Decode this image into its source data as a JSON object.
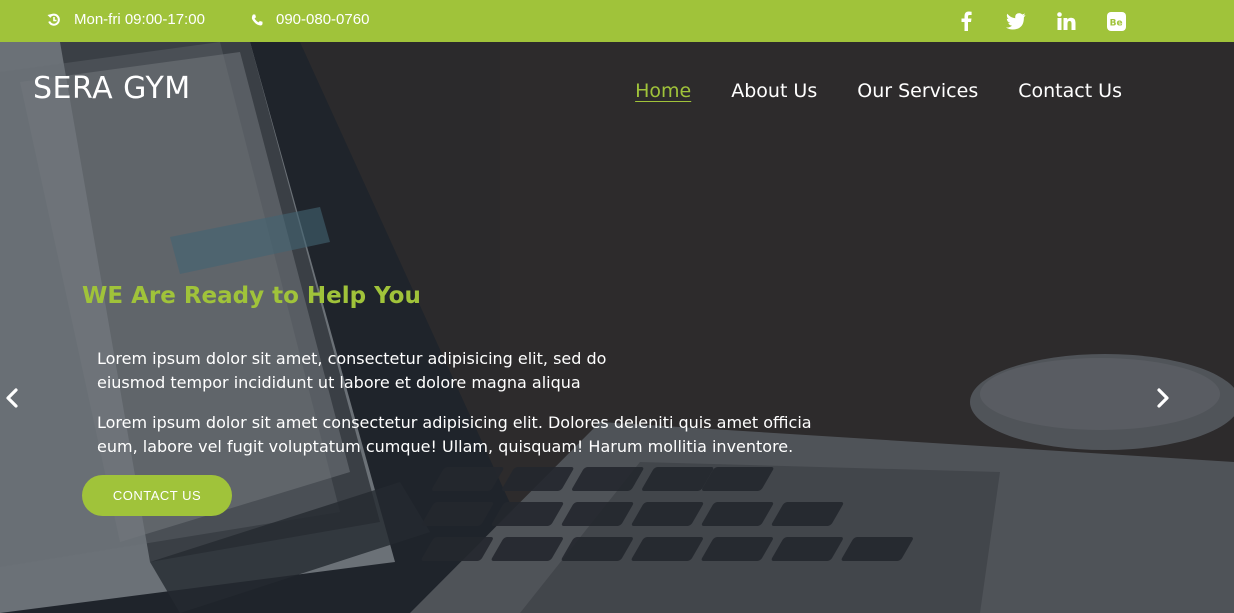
{
  "topbar": {
    "hours_icon": "clock-rotate-icon",
    "hours": "Mon-fri 09:00-17:00",
    "phone_icon": "phone-icon",
    "phone": "090-080-0760",
    "socials": [
      "facebook-icon",
      "twitter-icon",
      "linkedin-icon",
      "behance-icon"
    ],
    "bg_color": "#a0c33a"
  },
  "header": {
    "brand": "SERA GYM",
    "nav": [
      {
        "label": "Home",
        "active": true
      },
      {
        "label": "About Us",
        "active": false
      },
      {
        "label": "Our Services",
        "active": false
      },
      {
        "label": "Contact Us",
        "active": false
      }
    ]
  },
  "hero": {
    "headline": "WE Are Ready to Help You",
    "paragraph1": "Lorem ipsum dolor sit amet, consectetur adipisicing elit, sed do eiusmod tempor incididunt ut labore et dolore magna aliqua",
    "paragraph2": "Lorem ipsum dolor sit amet consectetur adipisicing elit. Dolores deleniti quis amet officia eum, labore vel fugit voluptatum cumque! Ullam, quisquam! Harum mollitia inventore.",
    "cta": "CONTACT US",
    "prev_icon": "chevron-left-icon",
    "next_icon": "chevron-right-icon",
    "accent_color": "#a0c33a"
  }
}
